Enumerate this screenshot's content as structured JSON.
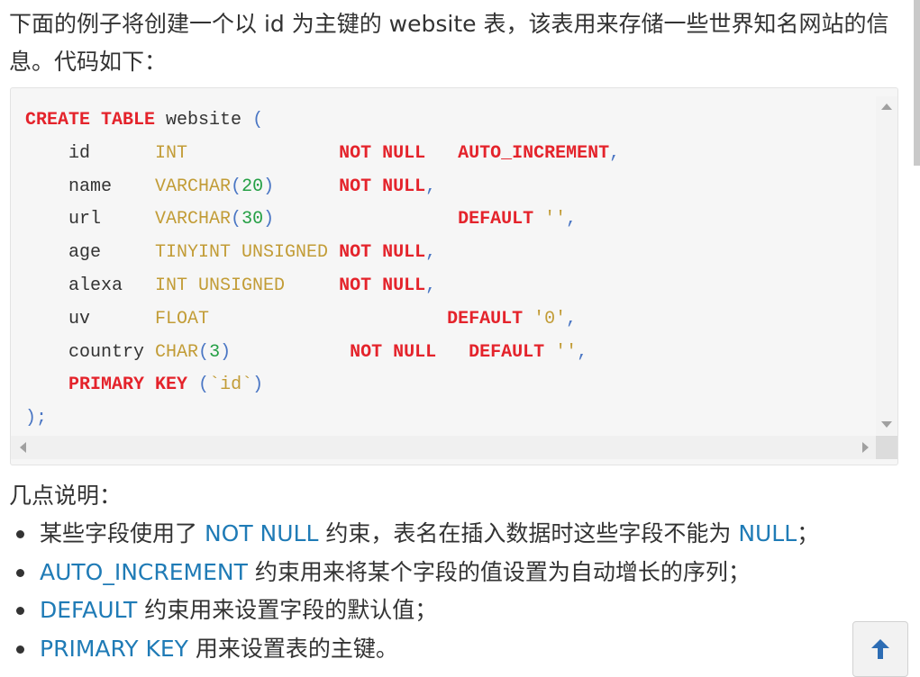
{
  "intro": "下面的例子将创建一个以 id 为主键的 website 表，该表用来存储一些世界知名网站的信息。代码如下：",
  "code": {
    "l1": {
      "create_table": "CREATE TABLE",
      "name": " website ",
      "open": "("
    },
    "l2": {
      "col": "id      ",
      "type": "INT              ",
      "nn": "NOT NULL",
      "sp": "   ",
      "ai": "AUTO_INCREMENT",
      "end": ","
    },
    "l3": {
      "col": "name    ",
      "type1": "VARCHAR",
      "p1": "(",
      "n": "20",
      "p2": ")",
      "sp": "      ",
      "nn": "NOT NULL",
      "end": ","
    },
    "l4": {
      "col": "url     ",
      "type1": "VARCHAR",
      "p1": "(",
      "n": "30",
      "p2": ")",
      "sp": "                 ",
      "def": "DEFAULT",
      "str": " ''",
      "end": ","
    },
    "l5": {
      "col": "age     ",
      "type": "TINYINT UNSIGNED",
      "sp": " ",
      "nn": "NOT NULL",
      "end": ","
    },
    "l6": {
      "col": "alexa   ",
      "type": "INT UNSIGNED",
      "sp": "     ",
      "nn": "NOT NULL",
      "end": ","
    },
    "l7": {
      "col": "uv      ",
      "type": "FLOAT",
      "sp": "                      ",
      "def": "DEFAULT",
      "str": " '0'",
      "end": ","
    },
    "l8": {
      "col": "country ",
      "type1": "CHAR",
      "p1": "(",
      "n": "3",
      "p2": ")",
      "sp": "           ",
      "nn": "NOT NULL",
      "sp2": "   ",
      "def": "DEFAULT",
      "str": " ''",
      "end": ","
    },
    "l9": {
      "pk": "PRIMARY KEY",
      "open": " (",
      "id": "`id`",
      "close": ")"
    },
    "l10": {
      "close": ")",
      "semi": ";"
    }
  },
  "notes_title": "几点说明：",
  "notes": [
    {
      "hl1": "NOT NULL",
      "t1": " 约束，表名在插入数据时这些字段不能为 ",
      "hl2": "NULL",
      "t2": "；",
      "pre": "某些字段使用了 "
    },
    {
      "hl1": "AUTO_INCREMENT",
      "t1": " 约束用来将某个字段的值设置为自动增长的序列；"
    },
    {
      "hl1": "DEFAULT",
      "t1": " 约束用来设置字段的默认值；"
    },
    {
      "hl1": "PRIMARY KEY",
      "t1": " 用来设置表的主键。"
    }
  ],
  "back_to_top_icon": "arrow-up-icon"
}
